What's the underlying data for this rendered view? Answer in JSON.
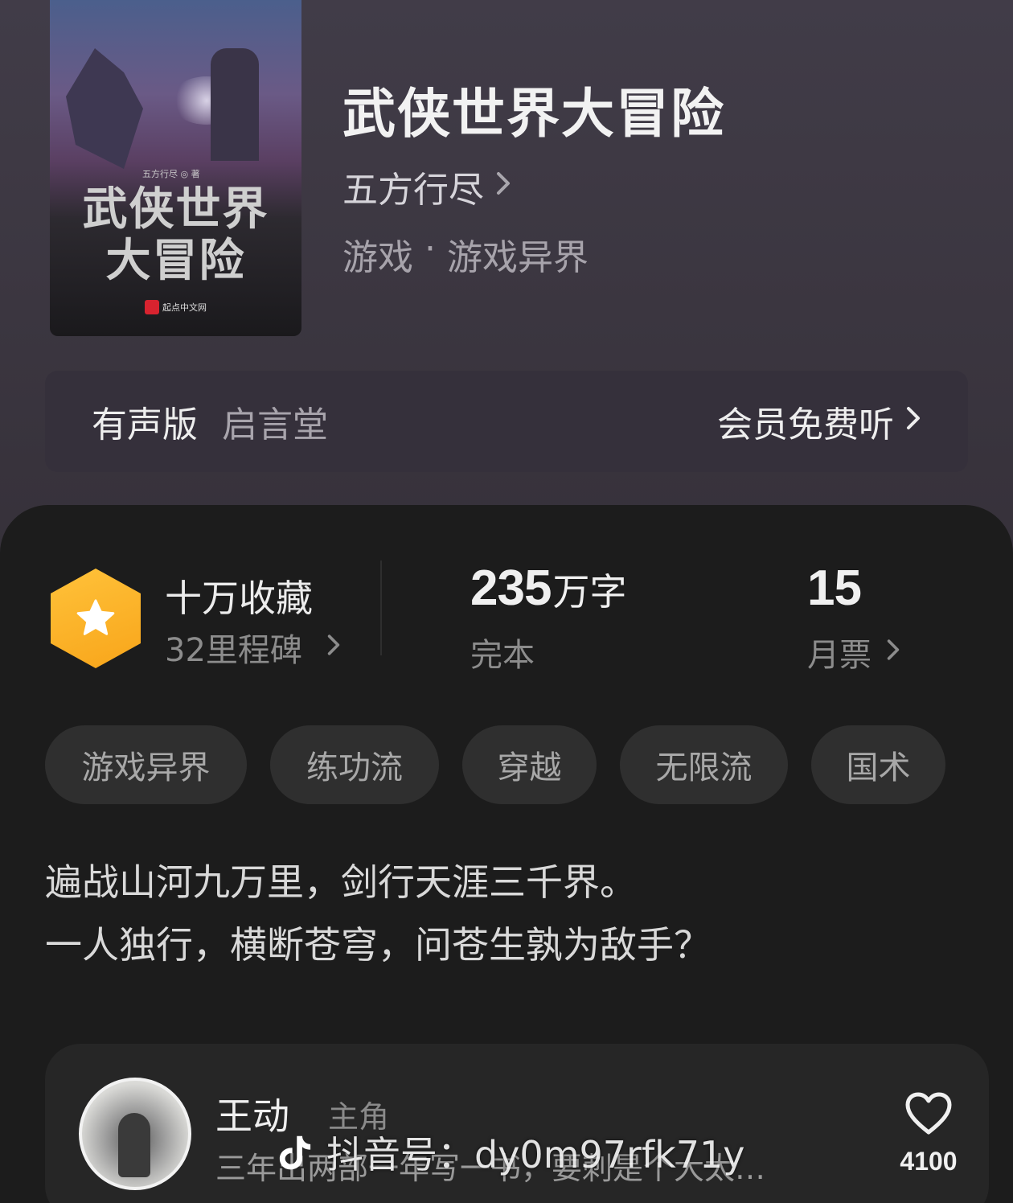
{
  "book": {
    "title": "武侠世界大冒险",
    "author": "五方行尽",
    "genre_main": "游戏",
    "genre_sep": " · ",
    "genre_sub": "游戏异界",
    "cover": {
      "author_line": "五方行尽 ◎ 著",
      "title_line1": "武侠世界",
      "title_line2": "大冒险",
      "publisher": "起点中文网"
    }
  },
  "audio": {
    "label": "有声版",
    "narrator": "启言堂",
    "cta": "会员免费听"
  },
  "stats": {
    "favorites_title": "十万收藏",
    "milestones": "32里程碑",
    "words_number": "235",
    "words_unit": "万字",
    "status": "完本",
    "monthly_votes": "15",
    "monthly_votes_label": "月票"
  },
  "tags": [
    "游戏异界",
    "练功流",
    "穿越",
    "无限流",
    "国术"
  ],
  "description": {
    "line1": "遍战山河九万里，剑行天涯三千界。",
    "line2": "一人独行，横断苍穹，问苍生孰为敌手？"
  },
  "character": {
    "name": "王动",
    "role": "主角",
    "desc": "三年出两部一年写一书，要刺是个大太…",
    "likes": "4100"
  },
  "watermark": {
    "text": "抖音号：dy0m97rfk71y"
  },
  "colors": {
    "accent_hex": "#f8a51a",
    "panel_bg": "#1c1c1c",
    "header_bg": "#3b3640"
  },
  "icons": [
    "chevron-right-icon",
    "star-icon",
    "heart-icon",
    "tiktok-icon"
  ]
}
